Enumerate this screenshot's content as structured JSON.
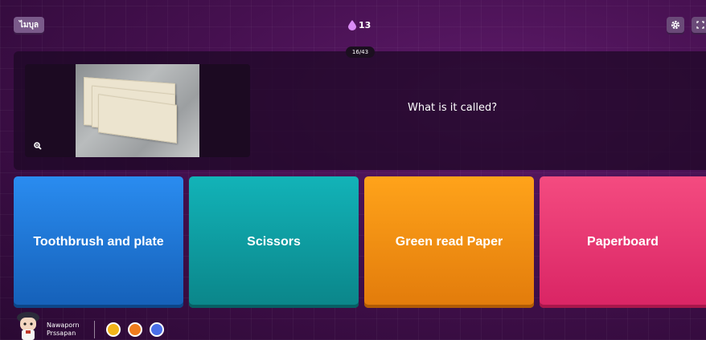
{
  "header": {
    "exit_label": "ไมบุล",
    "streak_count": "13",
    "progress": "16/43"
  },
  "question": {
    "text": "What is it called?"
  },
  "options": [
    {
      "label": "Toothbrush and plate",
      "color": "#1f78dc"
    },
    {
      "label": "Scissors",
      "color": "#0fa0a5"
    },
    {
      "label": "Green read Paper",
      "color": "#f28e12"
    },
    {
      "label": "Paperboard",
      "color": "#ea3a74"
    }
  ],
  "player": {
    "name": "Nawaporn Prssapan"
  },
  "powerups": [
    "star-powerup-icon",
    "fire-powerup-icon",
    "shield-powerup-icon"
  ]
}
